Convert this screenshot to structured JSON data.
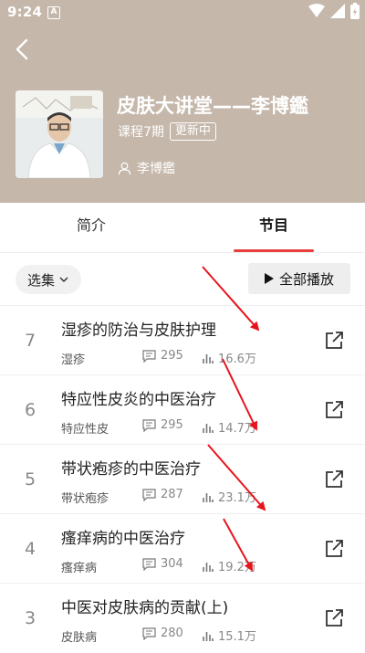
{
  "status_bar": {
    "time": "9:24",
    "app_icon": "A"
  },
  "header": {
    "title": "皮肤大讲堂——李博鑑",
    "course_count": "课程7期",
    "update_badge": "更新中",
    "author": "李博鑑",
    "background_color": "#c5b7aa"
  },
  "tabs": {
    "intro": "简介",
    "programs": "节目",
    "active_color": "#e8403c"
  },
  "toolbar": {
    "select_label": "选集",
    "play_all_label": "全部播放"
  },
  "episodes": [
    {
      "num": "7",
      "title": "湿疹的防治与皮肤护理",
      "tag": "湿疹",
      "comments": "295",
      "plays": "16.6万"
    },
    {
      "num": "6",
      "title": "特应性皮炎的中医治疗",
      "tag": "特应性皮",
      "comments": "295",
      "plays": "14.7万"
    },
    {
      "num": "5",
      "title": "带状疱疹的中医治疗",
      "tag": "带状疱疹",
      "comments": "287",
      "plays": "23.1万"
    },
    {
      "num": "4",
      "title": "瘙痒病的中医治疗",
      "tag": "瘙痒病",
      "comments": "304",
      "plays": "19.2万"
    },
    {
      "num": "3",
      "title": "中医对皮肤病的贡献(上)",
      "tag": "皮肤病",
      "comments": "280",
      "plays": "15.1万"
    }
  ],
  "annotation_color": "#e8141c"
}
